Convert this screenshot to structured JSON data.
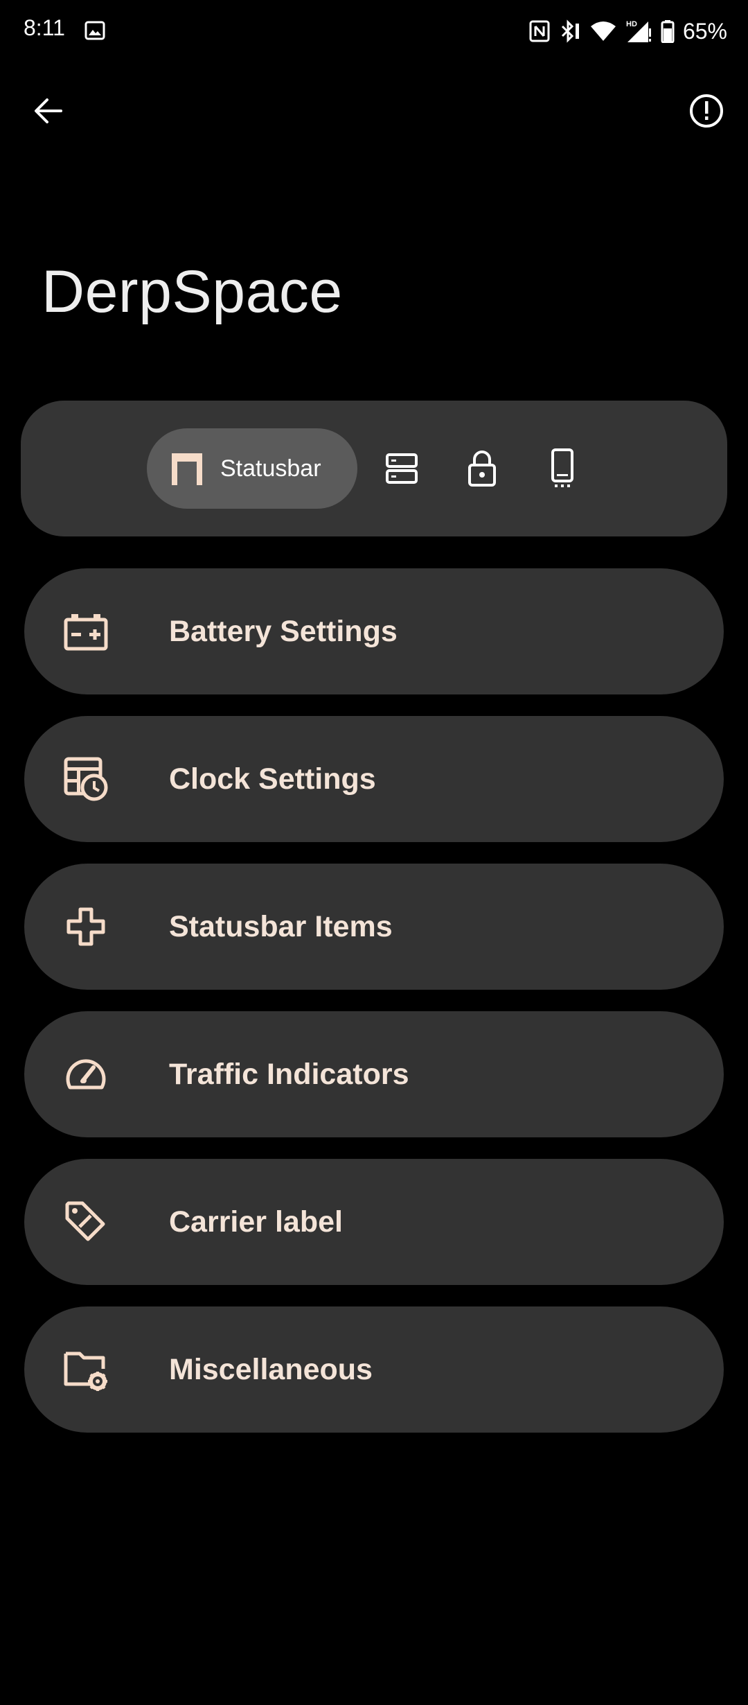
{
  "status_bar": {
    "time": "8:11",
    "battery_percent": "65%",
    "icons": [
      "gallery-icon",
      "nfc-icon",
      "bluetooth-icon",
      "wifi-icon",
      "signal-hd-icon",
      "battery-icon"
    ]
  },
  "app_bar": {
    "back_icon": "arrow-back-icon",
    "info_icon": "info-icon"
  },
  "page": {
    "title": "DerpSpace"
  },
  "tabs": {
    "selected_label": "Statusbar",
    "items": [
      {
        "icon": "statusbar-icon",
        "label": "Statusbar",
        "selected": true
      },
      {
        "icon": "quick-settings-icon",
        "selected": false
      },
      {
        "icon": "lock-icon",
        "selected": false
      },
      {
        "icon": "phone-icon",
        "selected": false
      }
    ]
  },
  "settings": {
    "items": [
      {
        "label": "Battery Settings",
        "icon": "battery-plus-icon"
      },
      {
        "label": "Clock Settings",
        "icon": "calendar-clock-icon"
      },
      {
        "label": "Statusbar Items",
        "icon": "plus-outline-icon"
      },
      {
        "label": "Traffic Indicators",
        "icon": "speedometer-icon"
      },
      {
        "label": "Carrier label",
        "icon": "tag-icon"
      },
      {
        "label": "Miscellaneous",
        "icon": "folder-gear-icon"
      }
    ]
  },
  "colors": {
    "background": "#000000",
    "card": "#333333",
    "accent": "#f6dcc9",
    "selected_tab": "#5b5b5b"
  }
}
